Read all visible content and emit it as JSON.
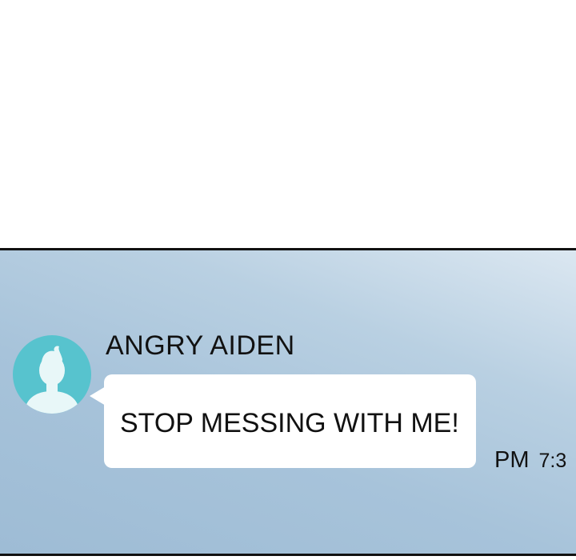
{
  "chat": {
    "sender_name": "ANGRY AIDEN",
    "avatar_icon": "user-silhouette-icon",
    "message": "STOP MESSING WITH ME!",
    "timestamp_ampm": "PM",
    "timestamp_time": "7:3"
  },
  "colors": {
    "panel_background": "#a7c3da",
    "avatar_background": "#57c3ce",
    "bubble_background": "#ffffff",
    "border": "#111111"
  }
}
